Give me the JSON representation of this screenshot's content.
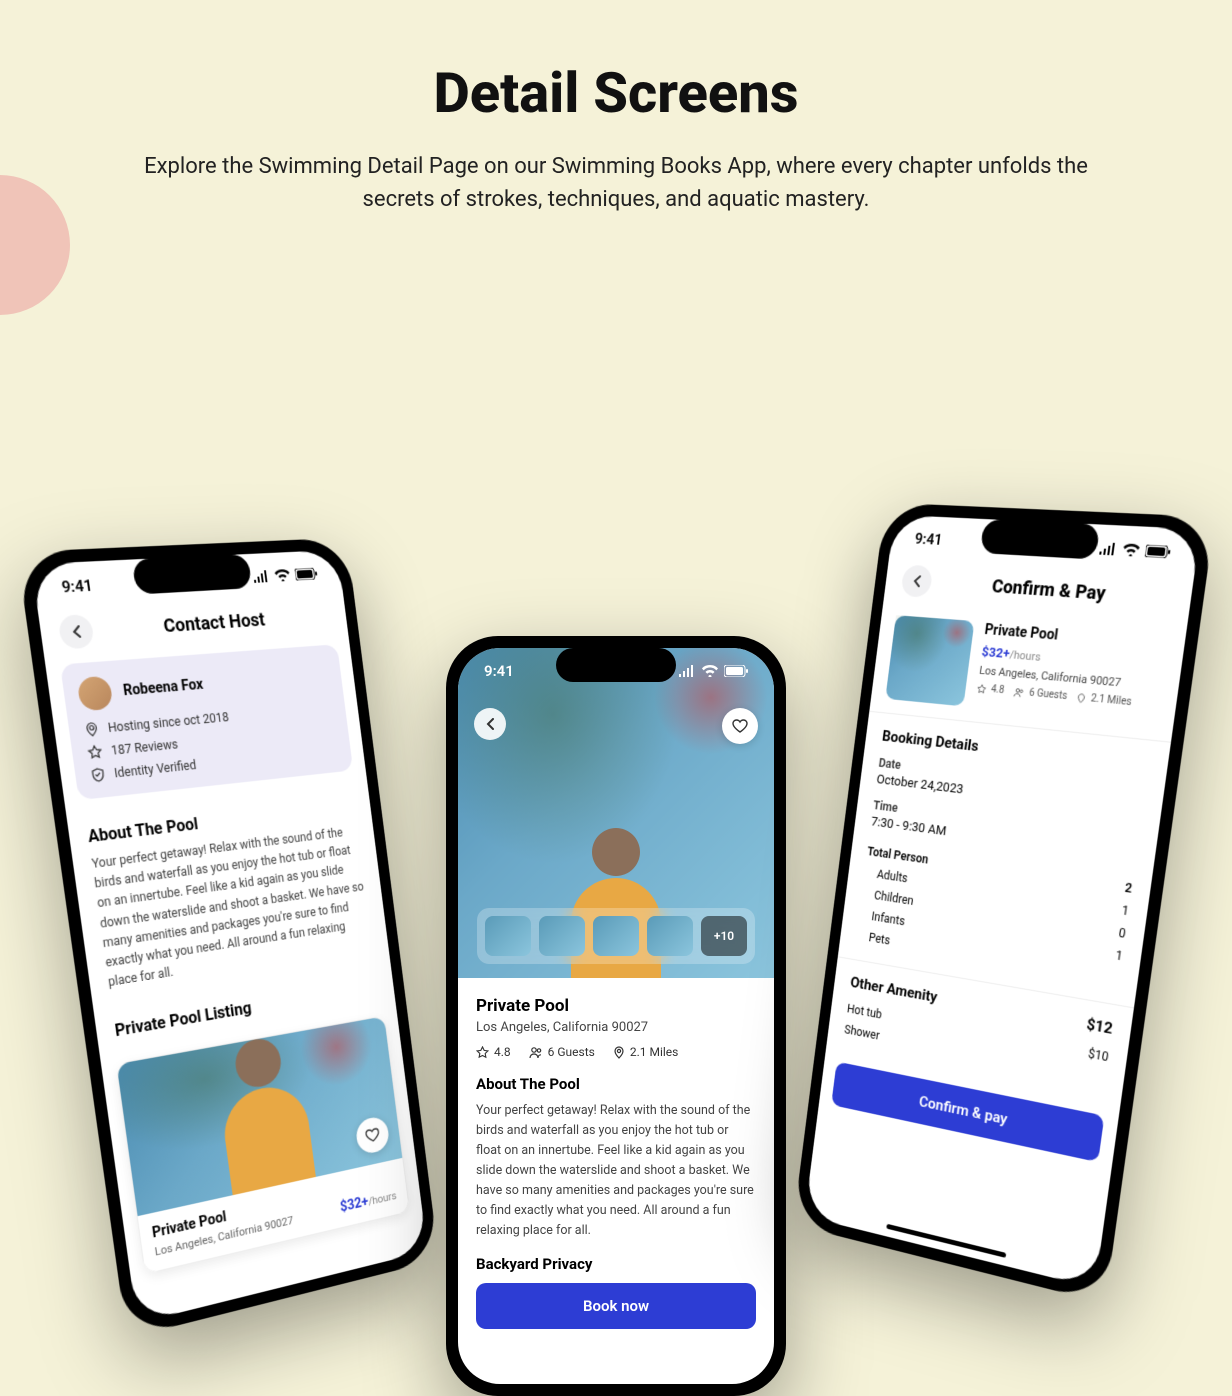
{
  "hero": {
    "title": "Detail Screens",
    "subtitle": "Explore the Swimming Detail Page on our Swimming Books App, where every chapter unfolds the secrets of strokes, techniques, and aquatic mastery."
  },
  "status_time": "9:41",
  "phone1": {
    "header_title": "Contact Host",
    "host_name": "Robeena Fox",
    "hosting_since": "Hosting since oct 2018",
    "reviews": "187 Reviews",
    "identity": "Identity Verified",
    "about_title": "About The Pool",
    "about_text": "Your perfect getaway! Relax with the sound of the birds and waterfall as you enjoy the hot tub or float on an innertube. Feel like a kid again as you slide down the waterslide and shoot a basket. We have so many amenities and packages you're sure to find exactly what you need. All around a fun relaxing place for all.",
    "listing_heading": "Private Pool Listing",
    "listing_title": "Private Pool",
    "listing_loc": "Los Angeles, California 90027",
    "price": "$32+",
    "price_unit": "/hours"
  },
  "phone2": {
    "more_thumbs": "+10",
    "title": "Private Pool",
    "location": "Los Angeles, California 90027",
    "rating": "4.8",
    "guests": "6 Guests",
    "miles": "2.1 Miles",
    "about_title": "About The Pool",
    "about_text": "Your perfect getaway! Relax with the sound of the birds and waterfall as you enjoy the hot tub or float on an innertube. Feel like a kid again as you slide down the waterslide and shoot a basket. We have so many amenities and packages you're sure to find exactly what you need. All around a fun relaxing place for all.",
    "privacy_title": "Backyard Privacy",
    "book_btn": "Book now"
  },
  "phone3": {
    "header_title": "Confirm & Pay",
    "summary_title": "Private Pool",
    "price": "$32+",
    "price_unit": "/hours",
    "location": "Los Angeles, California 90027",
    "rating": "4.8",
    "guests": "6 Guests",
    "miles": "2.1 Miles",
    "booking_title": "Booking Details",
    "date_label": "Date",
    "date_value": "October 24,2023",
    "time_label": "Time",
    "time_value": "7:30 - 9:30 AM",
    "total_person_label": "Total Person",
    "total_person_value": "2",
    "adults_label": "Adults",
    "adults_value": "1",
    "children_label": "Children",
    "children_value": "0",
    "infants_label": "Infants",
    "infants_value": "1",
    "pets_label": "Pets",
    "amenity_title": "Other Amenity",
    "amenity_total": "$12",
    "hottub_label": "Hot tub",
    "hottub_value": "$10",
    "shower_label": "Shower",
    "confirm_btn": "Confirm & pay"
  }
}
